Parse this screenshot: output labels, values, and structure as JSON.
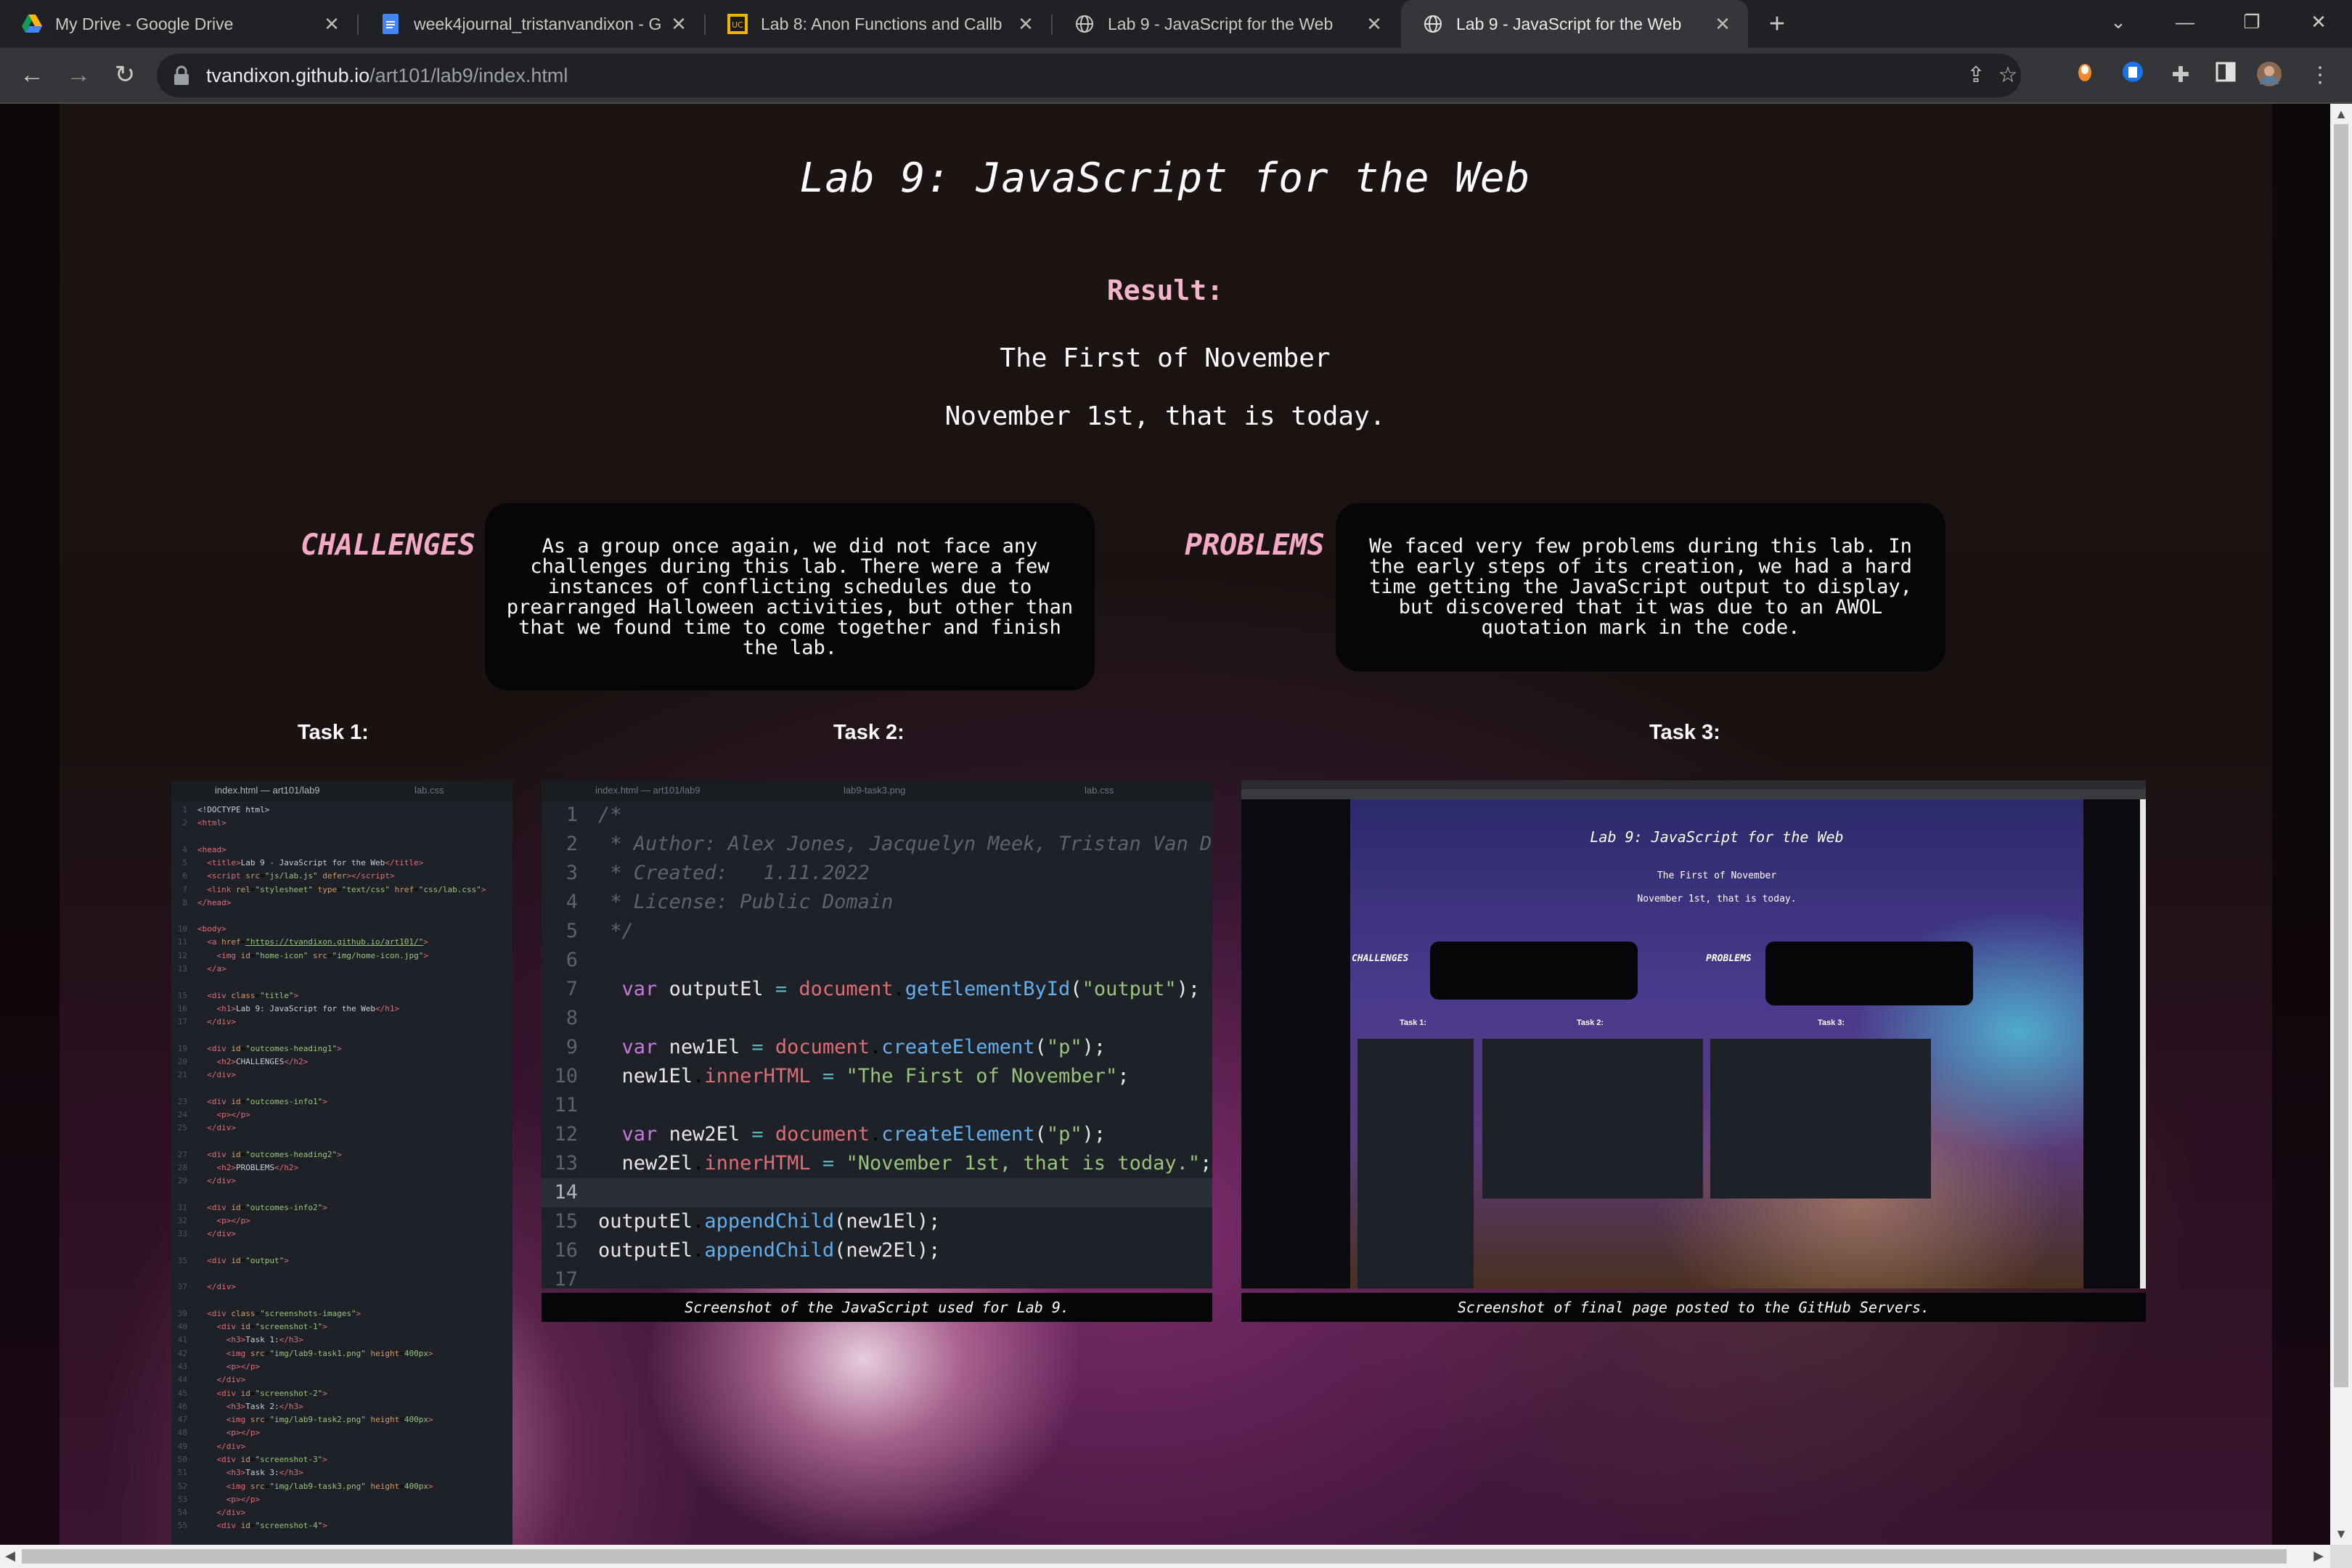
{
  "browser": {
    "tabs": [
      {
        "title": "My Drive - Google Drive",
        "icon": "google-drive-icon",
        "active": false
      },
      {
        "title": "week4journal_tristanvandixon - G",
        "icon": "google-docs-icon",
        "active": false
      },
      {
        "title": "Lab 8: Anon Functions and Callb",
        "icon": "course-site-icon",
        "active": false
      },
      {
        "title": "Lab 9 - JavaScript for the Web",
        "icon": "globe-icon",
        "active": false
      },
      {
        "title": "Lab 9 - JavaScript for the Web",
        "icon": "globe-icon",
        "active": true
      }
    ],
    "url_host": "tvandixon.github.io",
    "url_path": "/art101/lab9/index.html"
  },
  "page": {
    "title": "Lab 9: JavaScript for the Web",
    "result_heading": "Result:",
    "output_line1": "The First of November",
    "output_line2": "November 1st, that is today.",
    "challenges_heading": "CHALLENGES",
    "challenges_text": "As a group once again, we did not face any challenges during this lab. There were a few instances of conflicting schedules due to prearranged Halloween activities, but other than that we found time to come together and finish the lab.",
    "problems_heading": "PROBLEMS",
    "problems_text": "We faced very few problems during this lab. In the early steps of its creation, we had a hard time getting the JavaScript output to display, but discovered that it was due to an AWOL quotation mark in the code.",
    "task1_heading": "Task 1:",
    "task2_heading": "Task 2:",
    "task3_heading": "Task 3:",
    "task2_caption": "Screenshot of the JavaScript used for Lab 9.",
    "task3_caption": "Screenshot of final page posted to the GitHub Servers."
  },
  "task1_screenshot": {
    "tab_active": "index.html — art101/lab9",
    "tab_other": "lab.css"
  },
  "task2_screenshot": {
    "tab1": "index.html — art101/lab9",
    "tab2": "lab9-task3.png",
    "tab3": "lab.css",
    "comment_open": "/*",
    "comment_author": " * Author: Alex Jones, Jacquelyn Meek, Tristan Van Dixon",
    "comment_created": " * Created:   1.11.2022",
    "comment_license": " * License: Public Domain",
    "comment_close": " */"
  },
  "task3_screenshot": {
    "title": "Lab 9: JavaScript for the Web",
    "line1": "The First of November",
    "line2": "November 1st, that is today.",
    "challenges": "CHALLENGES",
    "problems": "PROBLEMS",
    "task1": "Task 1:",
    "task2": "Task 2:",
    "task3": "Task 3:"
  },
  "colors": {
    "accent_pink": "#f4a9c6",
    "result_pink": "#f3b6c8",
    "chrome_dark": "#202124",
    "chrome_toolbar": "#35363a"
  }
}
